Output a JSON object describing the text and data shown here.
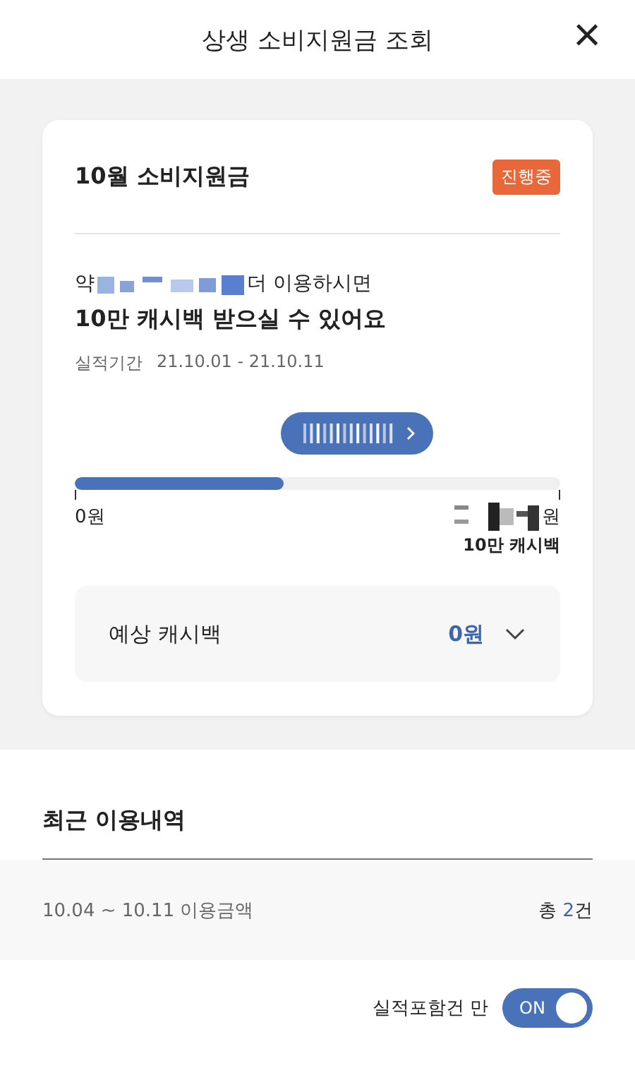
{
  "header": {
    "title": "상생 소비지원금 조회",
    "close": "×"
  },
  "card": {
    "title": "10월 소비지원금",
    "badge": "진행중",
    "remain_prefix": "약",
    "remain_suffix": "더 이용하시면",
    "headline": "10만 캐시백 받으실 수 있어요",
    "period_label": "실적기간",
    "period": "21.10.01 - 21.10.11",
    "progress": {
      "level": 0.43,
      "start_label": "0원",
      "end_unit": "원",
      "end_caption": "10만 캐시백"
    },
    "expected": {
      "label": "예상 캐시백",
      "value": "0원",
      "expanded": false
    }
  },
  "recent": {
    "title": "최근 이용내역",
    "range": "10.04 ~ 10.11 이용금액",
    "count_prefix": "총 ",
    "count": "2",
    "count_suffix": "건"
  },
  "filter": {
    "label": "실적포함건 만",
    "toggle_text": "ON",
    "on": true
  }
}
